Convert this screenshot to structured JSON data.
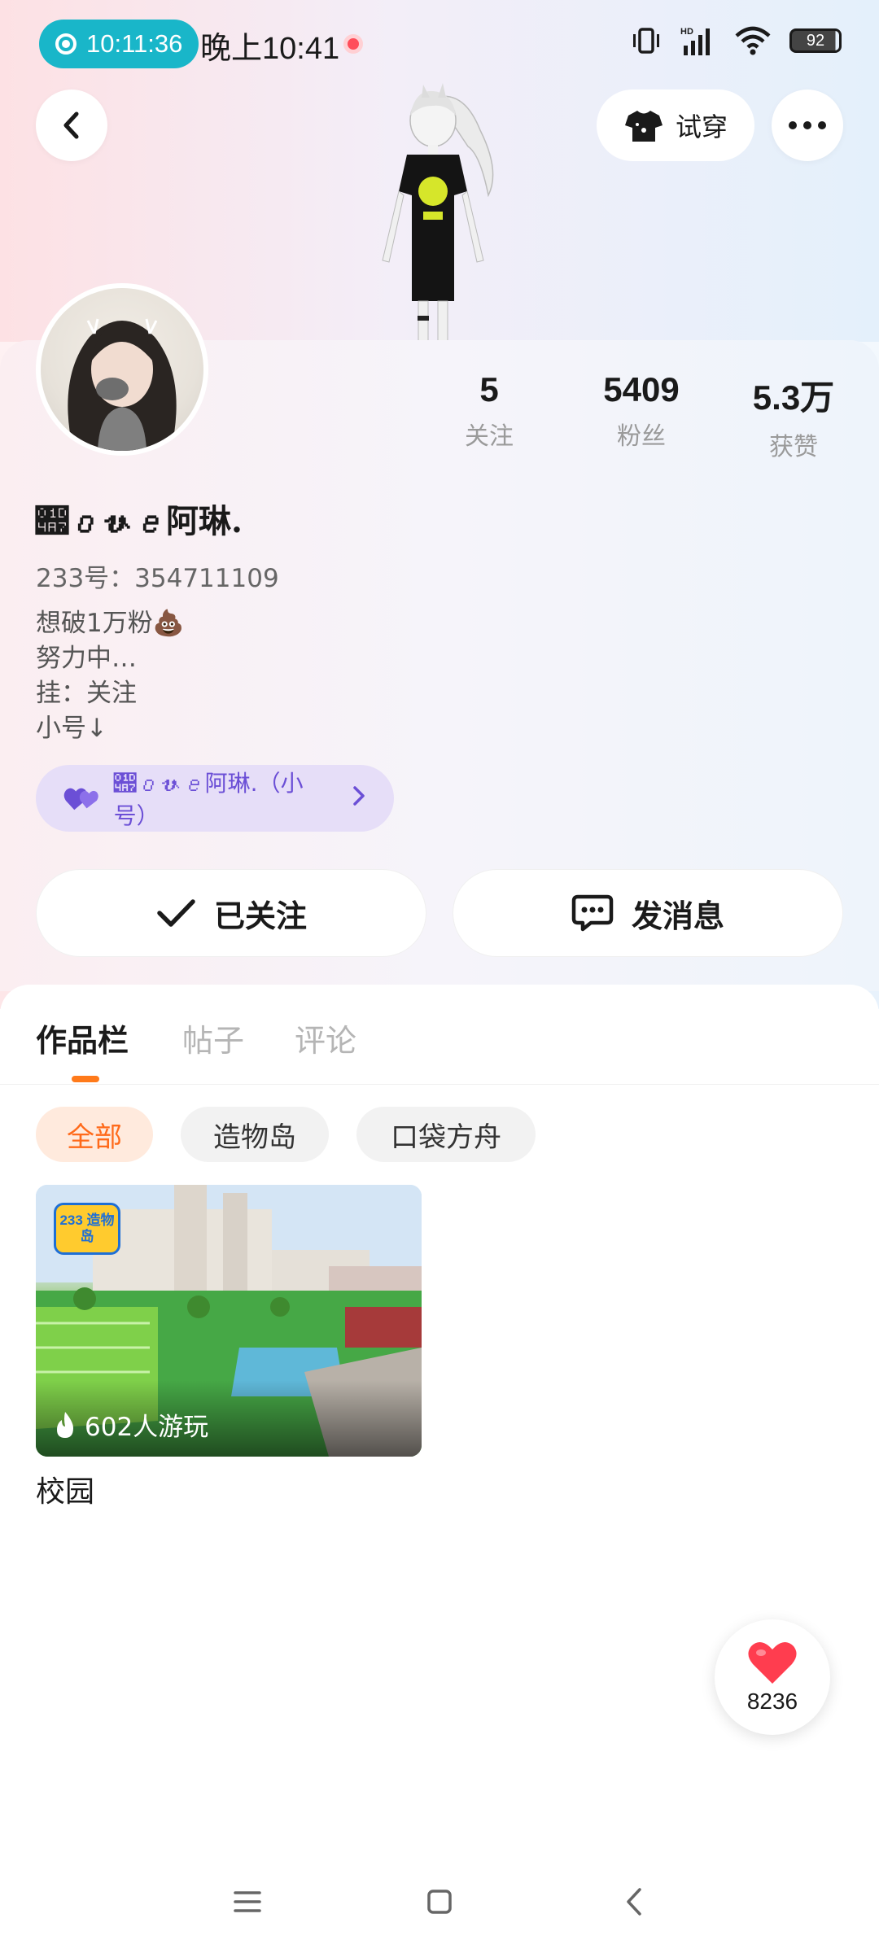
{
  "status_bar": {
    "recording_time": "10:11:36",
    "system_time": "晚上10:41",
    "battery": "92",
    "icons": [
      "vibrate-icon",
      "hd-signal-icon",
      "wifi-icon",
      "battery-icon"
    ]
  },
  "top_bar": {
    "back_icon": "chevron-left-icon",
    "try_on_label": "试穿",
    "try_on_icon": "tshirt-icon",
    "more_icon": "more-dots-icon"
  },
  "profile": {
    "nickname": "𝒧𝑜𝓋𝑒阿琳.",
    "uid": "233号：354711109",
    "bio": [
      "想破1万粉💩",
      "努力中…",
      "挂：关注",
      "小号↓"
    ],
    "stats": [
      {
        "value": "5",
        "label": "关注"
      },
      {
        "value": "5409",
        "label": "粉丝"
      },
      {
        "value": "5.3万",
        "label": "获赞"
      }
    ],
    "alt_account": {
      "label": "𝒧𝑜𝓋𝑒阿琳.（小号）",
      "icon": "double-heart-icon",
      "accent": "#6b4fd6"
    }
  },
  "actions": {
    "follow_label": "已关注",
    "message_label": "发消息"
  },
  "tabs": [
    {
      "label": "作品栏",
      "active": true
    },
    {
      "label": "帖子",
      "active": false
    },
    {
      "label": "评论",
      "active": false
    }
  ],
  "filters": [
    {
      "label": "全部",
      "active": true
    },
    {
      "label": "造物岛",
      "active": false
    },
    {
      "label": "口袋方舟",
      "active": false
    }
  ],
  "works": [
    {
      "title": "校园",
      "plays": "602人游玩",
      "badge": "233 造物岛"
    }
  ],
  "like_fab": {
    "count": "8236"
  },
  "colors": {
    "accent": "#ff7a1a",
    "status_pill": "#19b6c9",
    "alt_pill_bg": "#e6def8"
  }
}
